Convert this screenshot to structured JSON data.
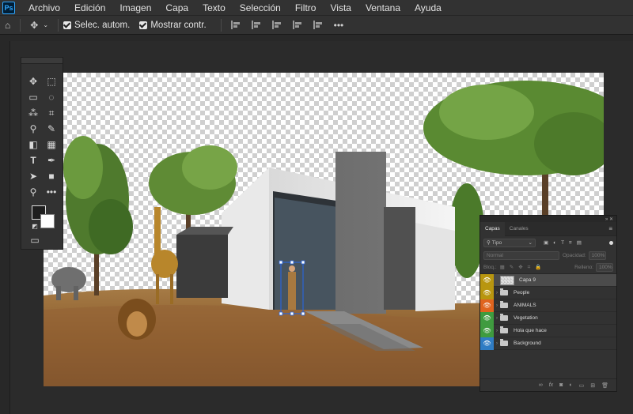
{
  "app": {
    "logo_text": "Ps"
  },
  "menubar": {
    "items": [
      "Archivo",
      "Edición",
      "Imagen",
      "Capa",
      "Texto",
      "Selección",
      "Filtro",
      "Vista",
      "Ventana",
      "Ayuda"
    ]
  },
  "options": {
    "auto_select_label": "Selec. autom.",
    "show_transform_label": "Mostrar contr."
  },
  "layers_panel": {
    "tabs": [
      "Capas",
      "Canales"
    ],
    "filter_value": "Tipo",
    "blend_mode": "Normal",
    "opacity_label": "Opacidad:",
    "opacity_value": "100%",
    "lock_label": "Bloq.:",
    "fill_label": "Relleno:",
    "fill_value": "100%",
    "layers": [
      {
        "name": "Capa 9",
        "color": "#b8960f",
        "type": "pixel"
      },
      {
        "name": "People",
        "color": "#b8960f",
        "type": "group"
      },
      {
        "name": "ANIMALS",
        "color": "#e0641e",
        "type": "group"
      },
      {
        "name": "Vegetation",
        "color": "#3f9b3f",
        "type": "group"
      },
      {
        "name": "Hola que hace",
        "color": "#3f9b3f",
        "type": "group"
      },
      {
        "name": "Background",
        "color": "#2f7cc4",
        "type": "group"
      }
    ]
  },
  "colors": {
    "accent": "#31a8ff",
    "panel": "#323232",
    "bg": "#282828"
  }
}
